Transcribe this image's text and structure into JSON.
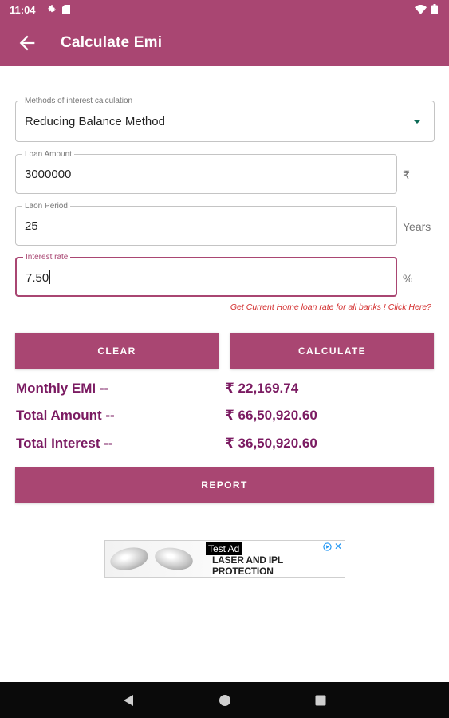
{
  "status_bar": {
    "time": "11:04"
  },
  "app_bar": {
    "title": "Calculate Emi"
  },
  "form": {
    "method": {
      "label": "Methods of interest calculation",
      "value": "Reducing Balance Method"
    },
    "loan_amount": {
      "label": "Loan Amount",
      "value": "3000000",
      "suffix": "₹"
    },
    "loan_period": {
      "label": "Laon Period",
      "value": "25",
      "suffix": "Years"
    },
    "interest_rate": {
      "label": "Interest rate",
      "value": "7.50",
      "suffix": "%"
    }
  },
  "rate_link": {
    "text": "Get Current Home loan rate for all banks ! ",
    "action": "Click Here?"
  },
  "buttons": {
    "clear": "CLEAR",
    "calculate": "CALCULATE",
    "report": "REPORT"
  },
  "results": {
    "monthly_emi": {
      "label": "Monthly EMI --",
      "value": "₹ 22,169.74"
    },
    "total_amount": {
      "label": "Total Amount --",
      "value": "₹ 66,50,920.60"
    },
    "total_interest": {
      "label": "Total Interest --",
      "value": "₹ 36,50,920.60"
    }
  },
  "ad": {
    "badge": "Test Ad",
    "title": "LASER AND IPL PROTECTION"
  },
  "colors": {
    "primary": "#a94672",
    "result_text": "#7b1b62",
    "link": "#d32f2f",
    "nav_bar": "#0a0a0a"
  }
}
